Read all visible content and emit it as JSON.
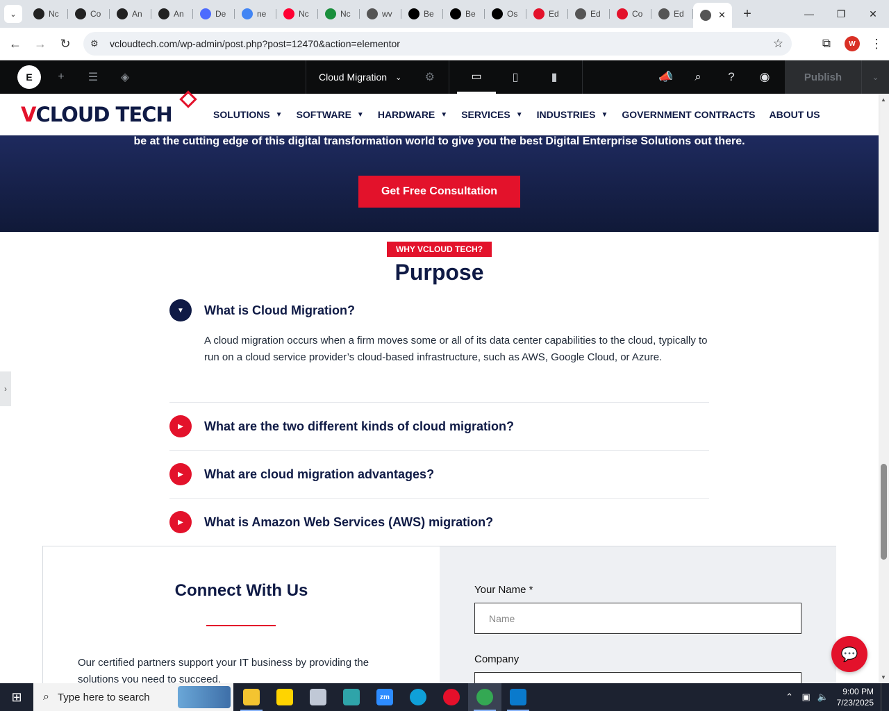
{
  "browser": {
    "tabs": [
      {
        "label": "Nc",
        "icon": "openai-icon",
        "color": "#222222"
      },
      {
        "label": "Co",
        "icon": "openai-icon",
        "color": "#222222"
      },
      {
        "label": "An",
        "icon": "openai-icon",
        "color": "#222222"
      },
      {
        "label": "An",
        "icon": "openai-icon",
        "color": "#222222"
      },
      {
        "label": "De",
        "icon": "deepseek-icon",
        "color": "#4d6bfe"
      },
      {
        "label": "ne",
        "icon": "google-icon",
        "color": "#4285f4"
      },
      {
        "label": "Nc",
        "icon": "youtube-icon",
        "color": "#ff0033"
      },
      {
        "label": "Nc",
        "icon": "webflow-icon",
        "color": "#1a8f3c"
      },
      {
        "label": "wv",
        "icon": "linkedin-icon",
        "color": "#555555"
      },
      {
        "label": "Be",
        "icon": "x-icon",
        "color": "#000000"
      },
      {
        "label": "Be",
        "icon": "x-icon",
        "color": "#000000"
      },
      {
        "label": "Os",
        "icon": "perplexity-icon",
        "color": "#000000"
      },
      {
        "label": "Ed",
        "icon": "elementor-tag-icon",
        "color": "#e3122b"
      },
      {
        "label": "Ed",
        "icon": "wordpress-icon",
        "color": "#555555"
      },
      {
        "label": "Co",
        "icon": "elementor-tag-icon",
        "color": "#e3122b"
      },
      {
        "label": "Ed",
        "icon": "wordpress-icon",
        "color": "#555555"
      }
    ],
    "active_tab_icon": "wordpress-icon",
    "url": "vcloudtech.com/wp-admin/post.php?post=12470&action=elementor",
    "profile_initial": "W"
  },
  "elementor": {
    "logo": "E",
    "document_name": "Cloud Migration",
    "publish_label": "Publish"
  },
  "site": {
    "logo_text_v": "V",
    "logo_text_rest": "CLOUD TECH",
    "nav": [
      {
        "label": "SOLUTIONS",
        "has_caret": true
      },
      {
        "label": "SOFTWARE",
        "has_caret": true
      },
      {
        "label": "HARDWARE",
        "has_caret": true
      },
      {
        "label": "SERVICES",
        "has_caret": true
      },
      {
        "label": "INDUSTRIES",
        "has_caret": true
      },
      {
        "label": "GOVERNMENT CONTRACTS",
        "has_caret": false
      },
      {
        "label": "ABOUT US",
        "has_caret": false
      }
    ],
    "colors": {
      "brand_red": "#e3122b",
      "navy": "#0f1a45"
    }
  },
  "hero": {
    "text": "be at the cutting edge of this digital transformation world to give you the best Digital Enterprise Solutions out there.",
    "cta_label": "Get Free Consultation"
  },
  "purpose": {
    "eyebrow": "WHY VCLOUD TECH?",
    "title": "Purpose",
    "faqs": [
      {
        "question": "What is Cloud Migration?",
        "answer": "A cloud migration occurs when a firm moves some or all of its data center capabilities to the cloud, typically to run on a cloud service provider’s cloud-based infrastructure, such as AWS, Google Cloud, or Azure.",
        "open": true
      },
      {
        "question": "What are the two different kinds of cloud migration?",
        "answer": "",
        "open": false
      },
      {
        "question": "What are cloud migration advantages?",
        "answer": "",
        "open": false
      },
      {
        "question": "What is Amazon Web Services (AWS) migration?",
        "answer": "",
        "open": false
      }
    ]
  },
  "connect": {
    "title": "Connect With Us",
    "text": "Our certified partners support your IT business by providing the solutions you need to succeed.",
    "name_label": "Your Name *",
    "name_placeholder": "Name",
    "company_label": "Company"
  },
  "taskbar": {
    "search_placeholder": "Type here to search",
    "apps": [
      {
        "name": "file-explorer-icon",
        "color": "#f4c430",
        "glyph": ""
      },
      {
        "name": "sticky-notes-icon",
        "color": "#ffd400",
        "glyph": ""
      },
      {
        "name": "paint-icon",
        "color": "#c0c8d6",
        "glyph": ""
      },
      {
        "name": "app-icon",
        "color": "#2fa4a9",
        "glyph": ""
      },
      {
        "name": "zoom-icon",
        "color": "#2d8cff",
        "glyph": "zm"
      },
      {
        "name": "edge-icon",
        "color": "#0fa0d8",
        "glyph": ""
      },
      {
        "name": "opera-icon",
        "color": "#e5102b",
        "glyph": ""
      },
      {
        "name": "chrome-icon",
        "color": "#34a853",
        "glyph": ""
      },
      {
        "name": "vscode-icon",
        "color": "#0a7acc",
        "glyph": ""
      }
    ],
    "time": "9:00 PM",
    "date": "7/23/2025"
  }
}
